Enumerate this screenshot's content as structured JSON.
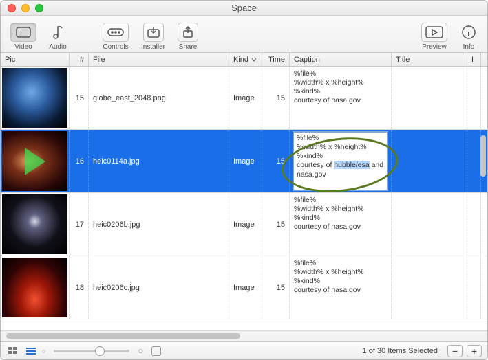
{
  "window": {
    "title": "Space"
  },
  "toolbar": {
    "video": "Video",
    "audio": "Audio",
    "controls": "Controls",
    "installer": "Installer",
    "share": "Share",
    "preview": "Preview",
    "info": "Info"
  },
  "columns": {
    "pic": "Pic",
    "num": "#",
    "file": "File",
    "kind": "Kind",
    "time": "Time",
    "caption": "Caption",
    "title": "Title",
    "i": "I"
  },
  "rows": [
    {
      "num": "15",
      "file": "globe_east_2048.png",
      "kind": "Image",
      "time": "15",
      "caption": "%file%\n%width% x %height% %kind%\ncourtesy of nasa.gov",
      "title": "",
      "thumb": "earth",
      "selected": false
    },
    {
      "num": "16",
      "file": "heic0114a.jpg",
      "kind": "Image",
      "time": "15",
      "caption_edit": {
        "pre": "%file%\n%width% x %height% %kind%\ncourtesy of ",
        "sel": "hubble/esa",
        "post": " and nasa.gov"
      },
      "title": "",
      "thumb": "nebula1",
      "selected": true
    },
    {
      "num": "17",
      "file": "heic0206b.jpg",
      "kind": "Image",
      "time": "15",
      "caption": "%file%\n%width% x %height% %kind%\ncourtesy of nasa.gov",
      "title": "",
      "thumb": "galaxy",
      "selected": false
    },
    {
      "num": "18",
      "file": "heic0206c.jpg",
      "kind": "Image",
      "time": "15",
      "caption": "%file%\n%width% x %height% %kind%\ncourtesy of nasa.gov",
      "title": "",
      "thumb": "nebula2",
      "selected": false
    }
  ],
  "footer": {
    "status": "1 of 30 Items Selected",
    "minus": "−",
    "plus": "+"
  },
  "thumb_styles": {
    "earth": "radial-gradient(circle at 45% 40%, #6fa8e6 0%, #2c5da0 35%, #0a1a33 70%, #000 100%)",
    "nebula1": "radial-gradient(ellipse at 40% 50%, #e0a060 0%, #7a3018 30%, #2a0808 70%, #000 100%)",
    "galaxy": "radial-gradient(ellipse at 50% 45%, #d8d8e8 0%, #606080 15%, #101018 55%, #000 100%)",
    "nebula2": "radial-gradient(ellipse at 50% 70%, #f05030 0%, #a01808 30%, #300404 65%, #000 100%)"
  }
}
